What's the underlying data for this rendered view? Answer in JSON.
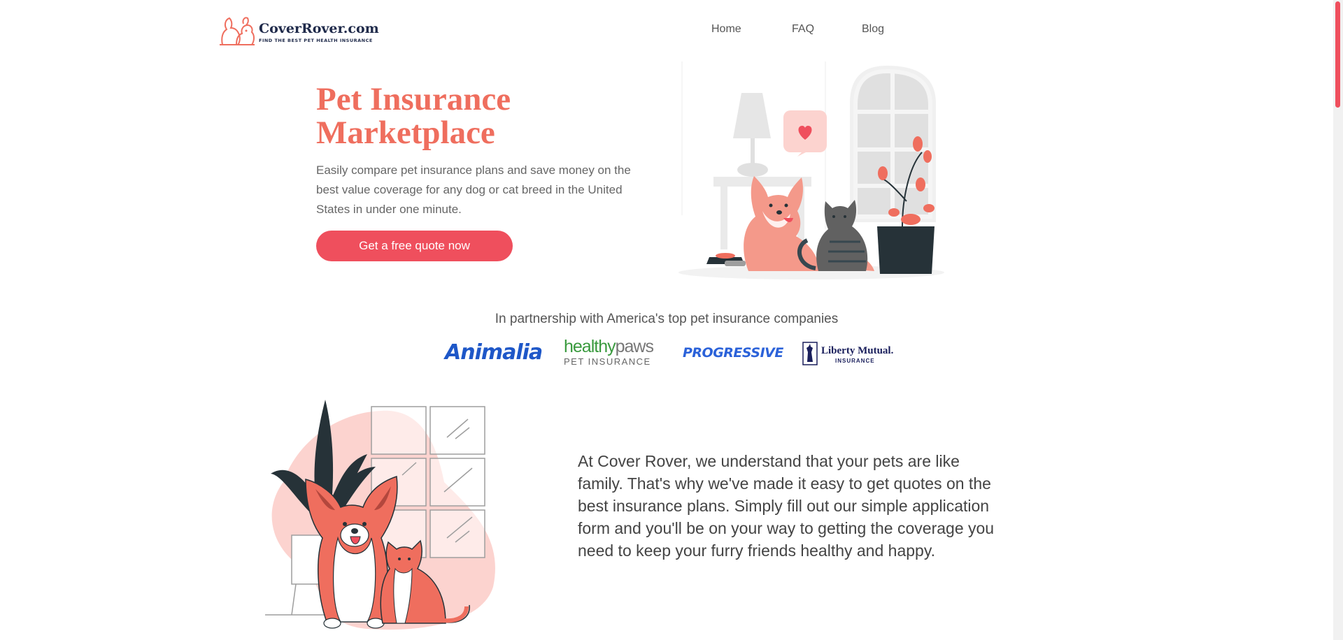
{
  "header": {
    "logo_title": "CoverRover.com",
    "logo_tagline": "FIND THE BEST PET HEALTH INSURANCE",
    "nav": [
      {
        "label": "Home"
      },
      {
        "label": "FAQ"
      },
      {
        "label": "Blog"
      }
    ]
  },
  "hero": {
    "title": "Pet Insurance Marketplace",
    "subtitle": "Easily compare pet insurance plans and save money on the best value coverage for any dog or cat breed in the United States in under one minute.",
    "cta_label": "Get a free quote now"
  },
  "partners": {
    "heading": "In partnership with America's top pet insurance companies",
    "logos": [
      {
        "name": "Animalia",
        "text": "Animalia"
      },
      {
        "name": "healthypaws",
        "text_main": "healthy",
        "text_accent": "paws",
        "text_sub": "PET INSURANCE"
      },
      {
        "name": "Progressive",
        "text": "PROGRESSIVE"
      },
      {
        "name": "Liberty Mutual",
        "text": "Liberty Mutual.",
        "text_sub": "INSURANCE"
      }
    ]
  },
  "about": {
    "text": "At Cover Rover, we understand that your pets are like family. That's why we've made it easy to get quotes on the best insurance plans. Simply fill out our simple application form and you'll be on your way to getting the coverage you need to keep your furry friends healthy and happy."
  },
  "colors": {
    "accent": "#ef4f5d",
    "title_coral": "#ef6e5e",
    "pink_light": "#fcd3cf",
    "dark": "#263238"
  }
}
